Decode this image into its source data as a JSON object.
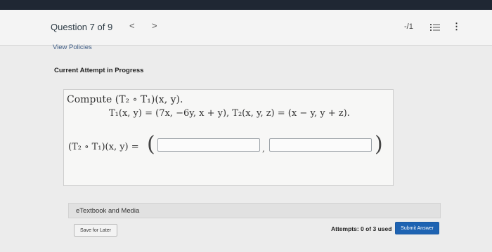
{
  "header": {
    "question_title": "Question 7 of 9",
    "prev_glyph": "<",
    "next_glyph": ">",
    "score": "-/1",
    "list_icon": "list-icon",
    "more_glyph": "⋮",
    "more_icon": "more-vertical-icon"
  },
  "links": {
    "view_policies": "View Policies"
  },
  "attempt": {
    "label": "Current Attempt in Progress"
  },
  "question": {
    "compute_text": "Compute (T₂ ∘ T₁)(x, y).",
    "definition_text": "T₁(x, y) = (7x, −6y, x + y),  T₂(x, y, z) = (x − y, y + z).",
    "answer_lhs": "(T₂ ∘ T₁)(x, y) =",
    "paren_open": "(",
    "paren_close": ")",
    "separator": ",",
    "answer_1_value": "",
    "answer_2_value": ""
  },
  "etextbook": {
    "label": "eTextbook and Media"
  },
  "footer": {
    "save_label": "Save for Later",
    "attempts_text": "Attempts: 0 of 3 used",
    "submit_label": "Submit Answer"
  },
  "colors": {
    "topbar": "#1f2733",
    "link": "#3f5d86",
    "submit_bg": "#1e63b2"
  }
}
